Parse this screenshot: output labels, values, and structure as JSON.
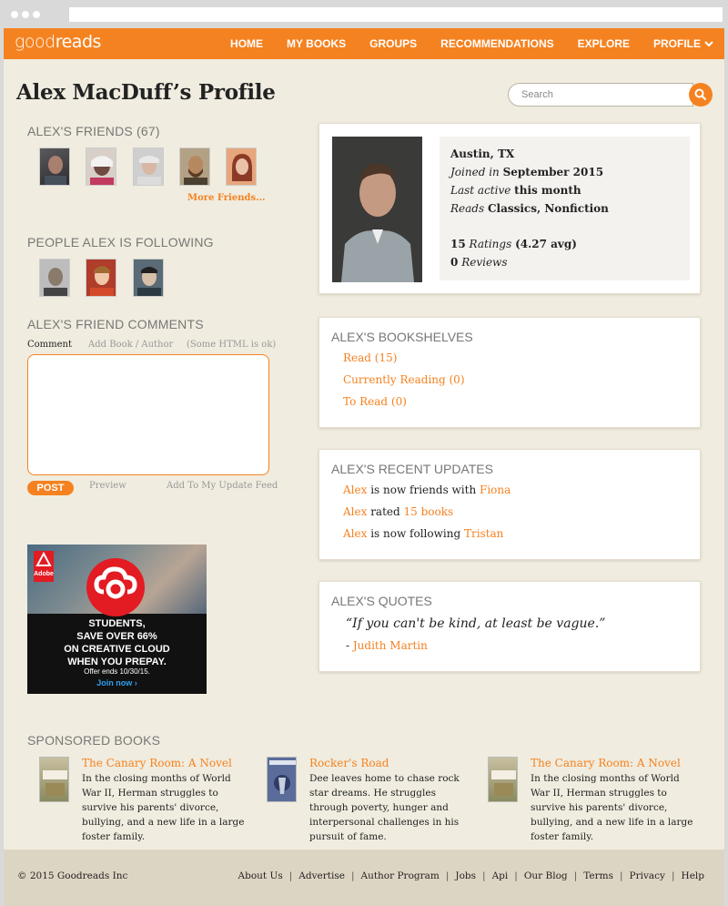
{
  "nav": {
    "logo_a": "good",
    "logo_b": "reads",
    "links": [
      "HOME",
      "MY BOOKS",
      "GROUPS",
      "RECOMMENDATIONS",
      "EXPLORE",
      "PROFILE"
    ]
  },
  "page_title": "Alex MacDuff’s Profile",
  "search": {
    "placeholder": "Search"
  },
  "friends": {
    "heading": "ALEX'S FRIENDS (67)",
    "more": "More Friends..."
  },
  "following": {
    "heading": "PEOPLE ALEX IS FOLLOWING"
  },
  "comments": {
    "heading": "ALEX'S FRIEND COMMENTS",
    "tab_comment": "Comment",
    "tab_add": "Add Book / Author",
    "html_note": "(Some HTML is ok)",
    "post": "POST",
    "preview": "Preview",
    "add_feed": "Add To My Update Feed"
  },
  "ad": {
    "brand": "Adobe",
    "line1": "STUDENTS,",
    "line2": "SAVE OVER 66%",
    "line3": "ON CREATIVE CLOUD",
    "line4": "WHEN YOU PREPAY.",
    "offer": "Offer ends 10/30/15.",
    "cta": "Join now ›"
  },
  "profile": {
    "location": "Austin, TX",
    "joined_label": "Joined in",
    "joined_value": "September 2015",
    "active_label": "Last active",
    "active_value": "this month",
    "reads_label": "Reads",
    "reads_value": "Classics, Nonfiction",
    "ratings_count": "15",
    "ratings_label": "Ratings",
    "ratings_avg": "(4.27 avg)",
    "reviews_count": "0",
    "reviews_label": "Reviews"
  },
  "bookshelves": {
    "heading": "ALEX'S BOOKSHELVES",
    "items": [
      "Read (15)",
      "Currently Reading (0)",
      "To Read (0)"
    ]
  },
  "updates": {
    "heading": "ALEX'S RECENT UPDATES",
    "items": [
      {
        "actor": "Alex",
        "text": " is now friends with ",
        "target": "Fiona"
      },
      {
        "actor": "Alex",
        "text": " rated ",
        "target": "15 books"
      },
      {
        "actor": "Alex",
        "text": " is now following ",
        "target": "Tristan"
      }
    ]
  },
  "quotes": {
    "heading": "ALEX'S QUOTES",
    "quote": "“If you can't be kind, at least be vague.”",
    "dash": "- ",
    "author": "Judith Martin"
  },
  "sponsored": {
    "heading": "SPONSORED BOOKS",
    "books": [
      {
        "title": "The Canary Room: A Novel",
        "desc": "In the closing months of World War II, Herman struggles to survive his parents' divorce, bullying, and a new life in a large foster family."
      },
      {
        "title": "Rocker's Road",
        "desc": "Dee leaves home to chase rock star dreams. He struggles through poverty, hunger and interpersonal challenges in his pursuit of fame."
      },
      {
        "title": "The Canary Room: A Novel",
        "desc": "In the closing months of World War II, Herman struggles to survive his parents' divorce, bullying, and a new life in a large foster family."
      }
    ]
  },
  "footer": {
    "copyright": "© 2015 Goodreads Inc",
    "links": [
      "About Us",
      "Advertise",
      "Author Program",
      "Jobs",
      "Api",
      "Our Blog",
      "Terms",
      "Privacy",
      "Help"
    ]
  },
  "colors": {
    "accent": "#f58220",
    "background": "#f0ecdf",
    "footer": "#ddd5c3"
  }
}
